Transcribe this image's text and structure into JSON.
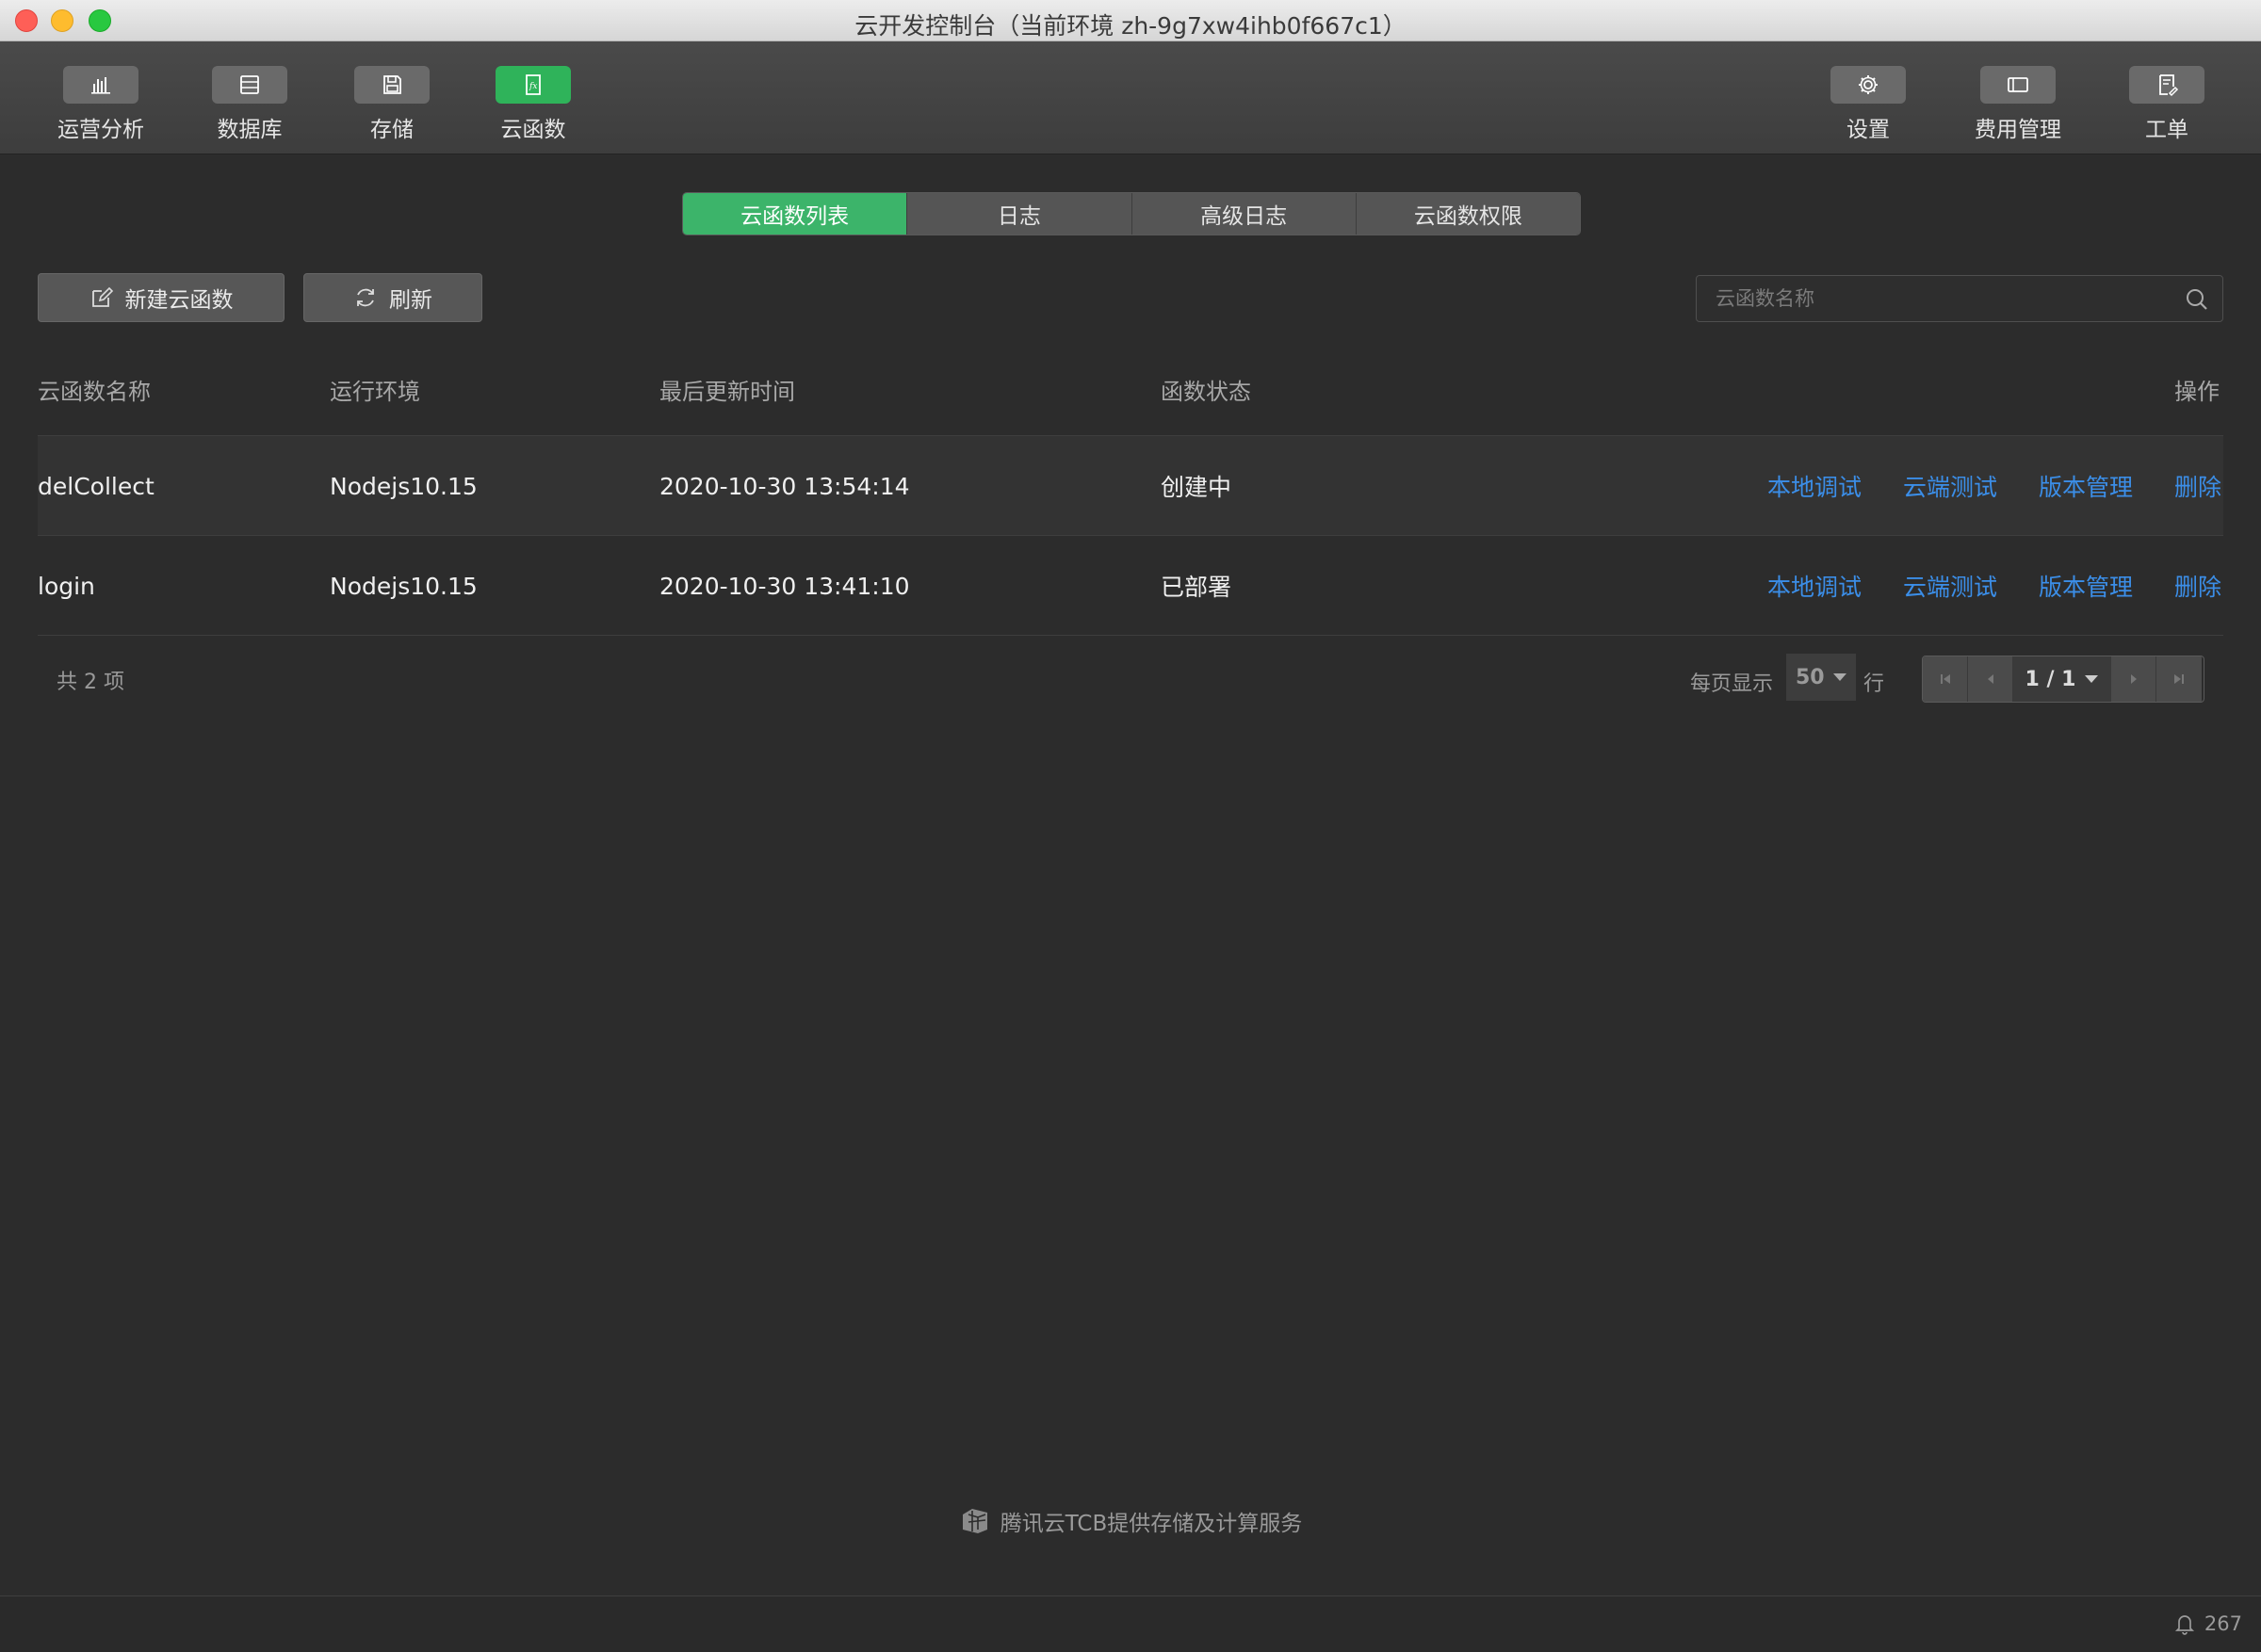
{
  "window": {
    "title": "云开发控制台（当前环境 zh-9g7xw4ihb0f667c1）"
  },
  "toolbar": {
    "left": [
      {
        "label": "运营分析",
        "icon": "bar-chart-icon"
      },
      {
        "label": "数据库",
        "icon": "database-icon"
      },
      {
        "label": "存储",
        "icon": "storage-icon"
      },
      {
        "label": "云函数",
        "icon": "function-icon",
        "active": true
      }
    ],
    "right": [
      {
        "label": "设置",
        "icon": "gear-icon"
      },
      {
        "label": "费用管理",
        "icon": "billing-icon"
      },
      {
        "label": "工单",
        "icon": "ticket-icon"
      }
    ]
  },
  "tabs": [
    {
      "label": "云函数列表",
      "active": true
    },
    {
      "label": "日志"
    },
    {
      "label": "高级日志"
    },
    {
      "label": "云函数权限"
    }
  ],
  "actions": {
    "new_label": "新建云函数",
    "refresh_label": "刷新"
  },
  "search": {
    "placeholder": "云函数名称"
  },
  "table": {
    "headers": {
      "name": "云函数名称",
      "runtime": "运行环境",
      "updated": "最后更新时间",
      "status": "函数状态",
      "ops": "操作"
    },
    "rows": [
      {
        "name": "delCollect",
        "runtime": "Nodejs10.15",
        "updated": "2020-10-30 13:54:14",
        "status": "创建中"
      },
      {
        "name": "login",
        "runtime": "Nodejs10.15",
        "updated": "2020-10-30 13:41:10",
        "status": "已部署"
      }
    ],
    "ops": [
      "本地调试",
      "云端测试",
      "版本管理",
      "删除"
    ]
  },
  "pagination": {
    "total": "共 2 项",
    "per_page_label": "每页显示",
    "per_page_value": "50",
    "row_label": "行",
    "page": "1 / 1"
  },
  "footer": {
    "brand": "腾讯云TCB提供存储及计算服务",
    "notification_count": "267"
  },
  "colors": {
    "accent_green": "#3cb46a",
    "link_blue": "#3b8ee8",
    "background": "#2c2c2c"
  }
}
